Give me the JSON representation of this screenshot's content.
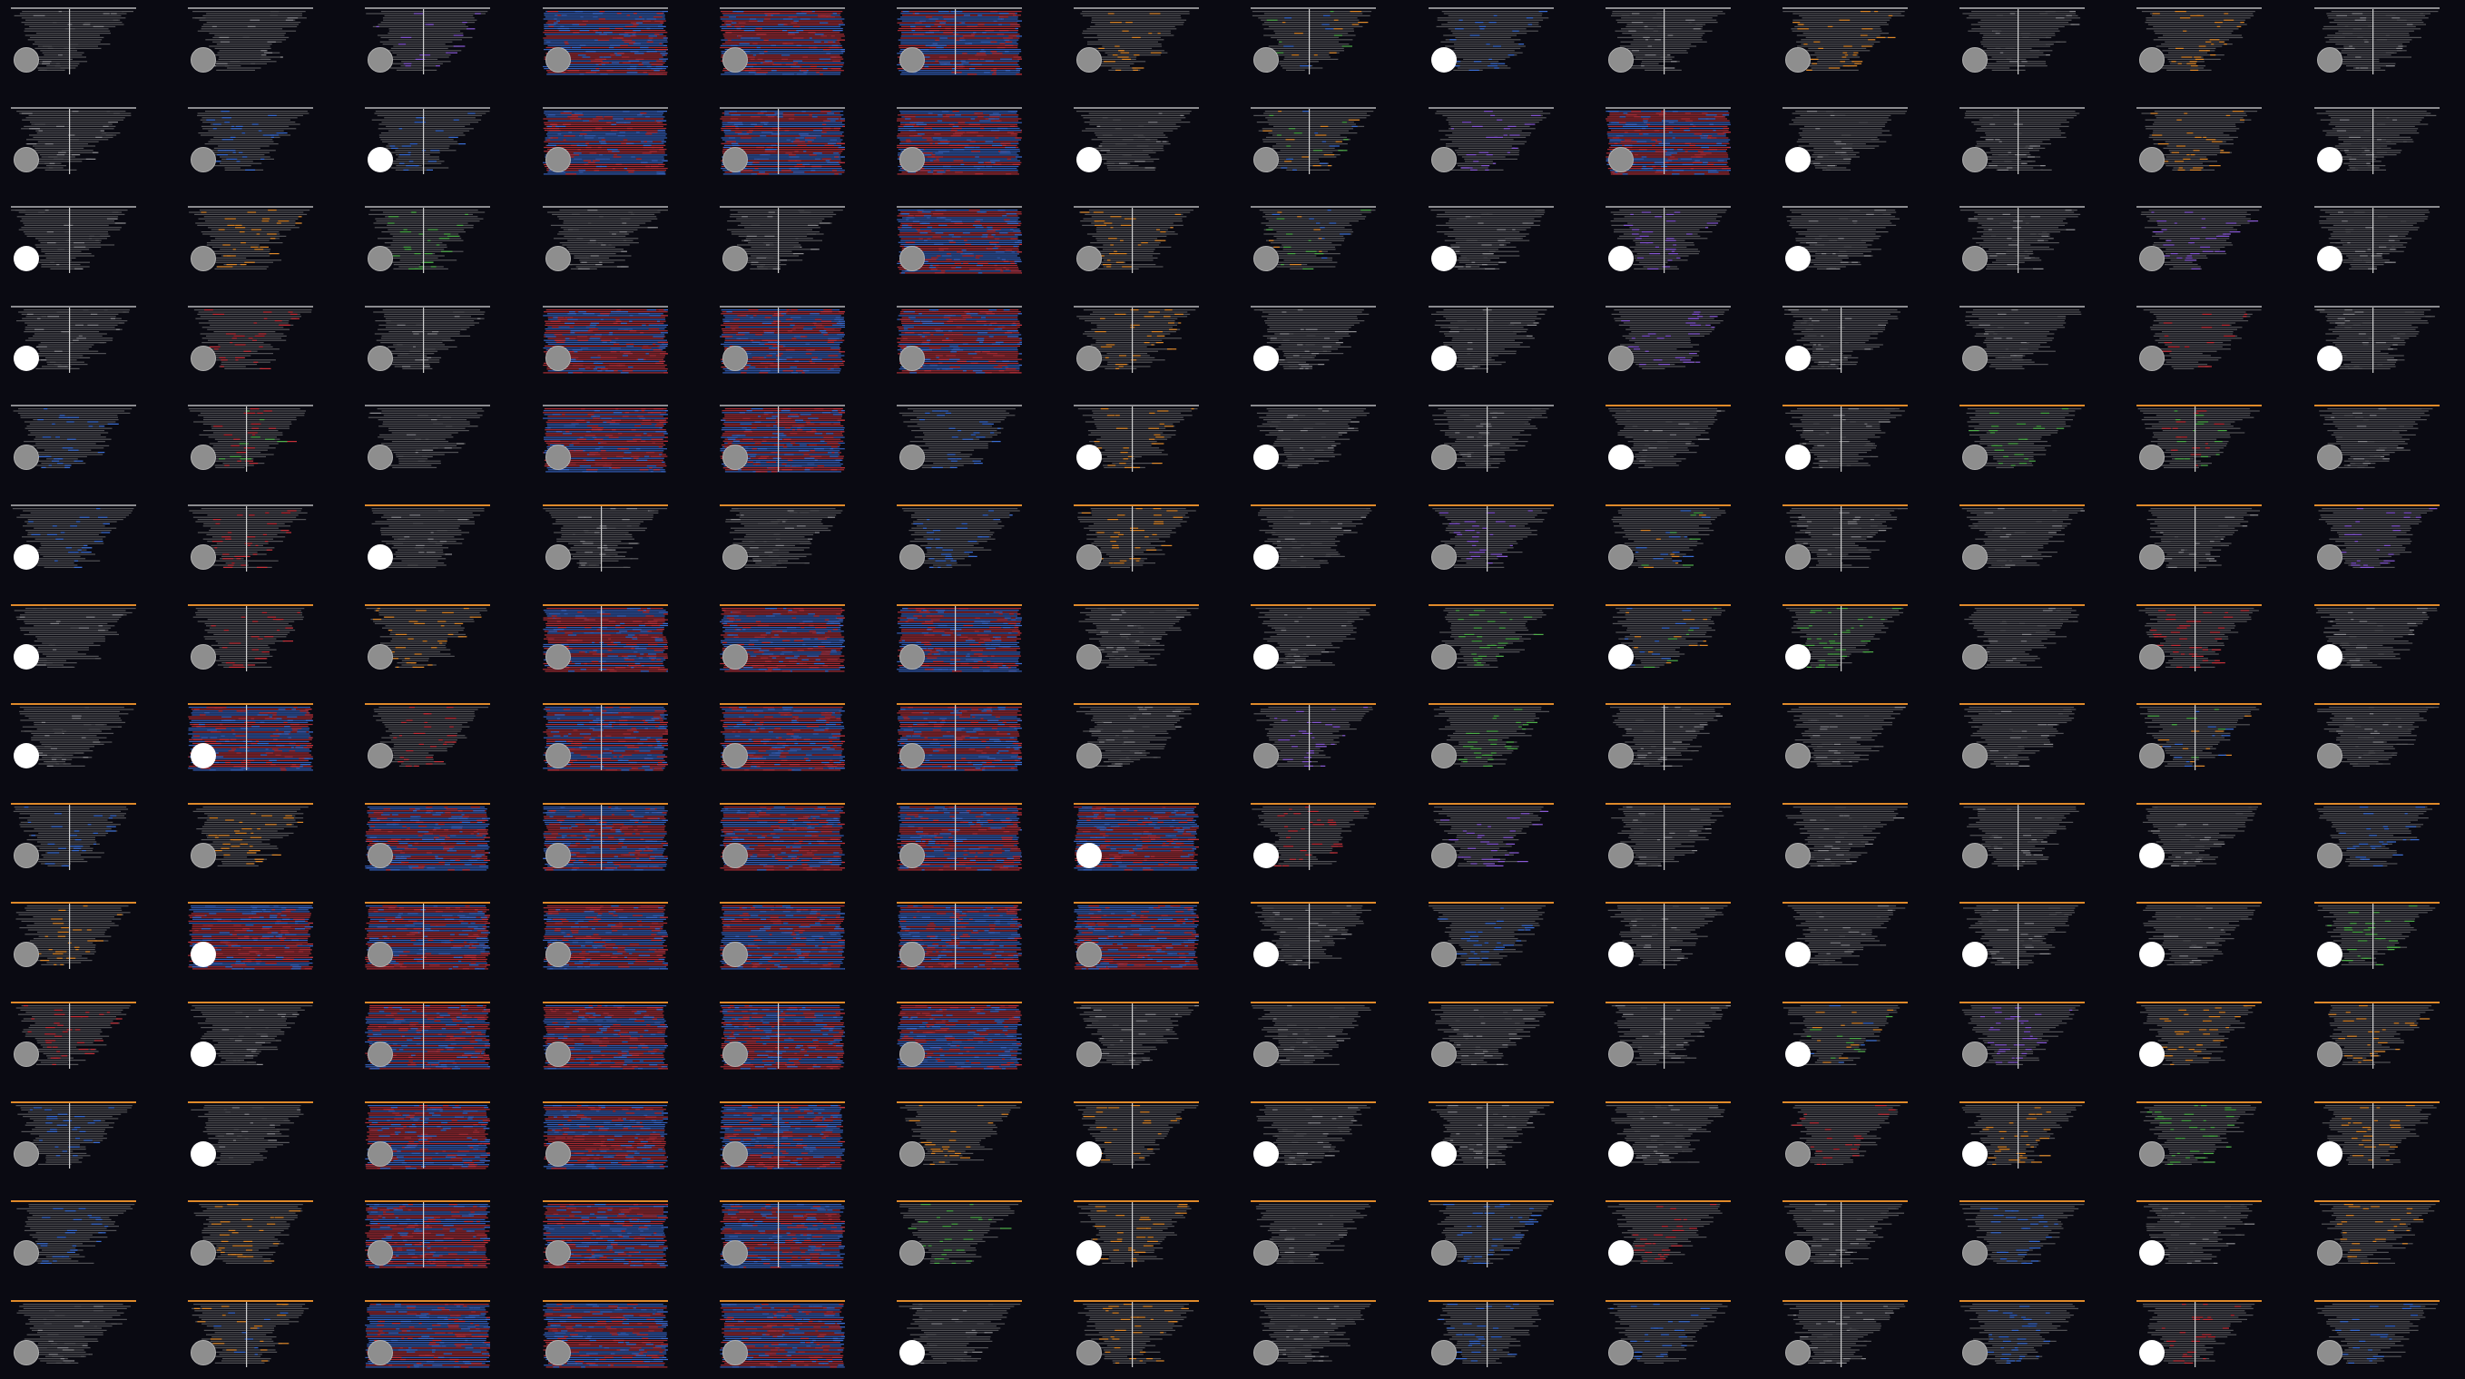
{
  "grid": {
    "rows": 14,
    "cols": 14,
    "background": "#0a0a12"
  },
  "palette": {
    "gray": "#5a5a5e",
    "light_gray": "#8c8c90",
    "blue": "#3b6fd6",
    "red": "#c8323a",
    "orange": "#e08a2a",
    "green": "#4fb04a",
    "purple": "#8a5ad6",
    "selected_dot": "#ffffff",
    "unselected_dot": "#8e8e8e"
  },
  "selection_dot_icon": "circle-toggle-icon",
  "selected": [
    [
      0,
      0,
      0,
      0,
      0,
      0,
      0,
      0,
      1,
      0,
      0,
      0,
      0,
      0
    ],
    [
      0,
      0,
      1,
      0,
      0,
      0,
      1,
      0,
      0,
      0,
      1,
      0,
      0,
      1
    ],
    [
      1,
      0,
      0,
      0,
      0,
      0,
      0,
      0,
      1,
      1,
      1,
      0,
      0,
      1
    ],
    [
      1,
      0,
      0,
      0,
      0,
      0,
      0,
      1,
      1,
      0,
      1,
      0,
      0,
      1
    ],
    [
      0,
      0,
      0,
      0,
      0,
      0,
      1,
      1,
      0,
      1,
      1,
      0,
      0,
      0
    ],
    [
      1,
      0,
      1,
      0,
      0,
      0,
      0,
      1,
      0,
      0,
      0,
      0,
      0,
      0
    ],
    [
      1,
      0,
      0,
      0,
      0,
      0,
      0,
      1,
      0,
      1,
      1,
      0,
      0,
      1
    ],
    [
      1,
      1,
      0,
      0,
      0,
      0,
      0,
      0,
      0,
      0,
      0,
      0,
      0,
      0
    ],
    [
      0,
      0,
      0,
      0,
      0,
      0,
      1,
      1,
      0,
      0,
      0,
      0,
      1,
      0
    ],
    [
      0,
      1,
      0,
      0,
      0,
      0,
      0,
      1,
      0,
      1,
      1,
      1,
      1,
      1
    ],
    [
      0,
      1,
      0,
      0,
      0,
      0,
      0,
      0,
      0,
      0,
      1,
      0,
      1,
      0
    ],
    [
      0,
      1,
      0,
      0,
      0,
      0,
      1,
      1,
      1,
      1,
      0,
      1,
      0,
      1
    ],
    [
      0,
      0,
      0,
      0,
      0,
      0,
      1,
      0,
      0,
      1,
      0,
      0,
      1,
      0
    ],
    [
      0,
      0,
      0,
      0,
      0,
      1,
      0,
      0,
      0,
      0,
      0,
      0,
      1,
      0
    ]
  ],
  "thumb_style": [
    [
      "g",
      "g",
      "gp",
      "rb",
      "b",
      "rb",
      "go",
      "og",
      "gb",
      "g",
      "go",
      "g",
      "go",
      "g"
    ],
    [
      "g",
      "gb",
      "gb",
      "rb",
      "b",
      "rb",
      "g",
      "og",
      "gp",
      "r",
      "g",
      "g",
      "go",
      "g"
    ],
    [
      "g",
      "go",
      "gg",
      "g",
      "g",
      "rb",
      "go",
      "og",
      "g",
      "gp",
      "g",
      "g",
      "gp",
      "g"
    ],
    [
      "g",
      "gr",
      "g",
      "rb",
      "rb",
      "rb",
      "go",
      "g",
      "g",
      "gp",
      "g",
      "g",
      "gr",
      "g"
    ],
    [
      "gb",
      "rg",
      "g",
      "b",
      "rb",
      "gb",
      "go",
      "g",
      "g",
      "g",
      "g",
      "gg",
      "rg",
      "g"
    ],
    [
      "gb",
      "gr",
      "g",
      "g",
      "g",
      "gb",
      "go",
      "g",
      "gp",
      "og",
      "g",
      "g",
      "g",
      "gp"
    ],
    [
      "g",
      "gr",
      "go",
      "rb",
      "b",
      "rb",
      "g",
      "g",
      "gg",
      "og",
      "gg",
      "g",
      "gr",
      "g"
    ],
    [
      "g",
      "b",
      "gr",
      "rb",
      "rb",
      "rb",
      "g",
      "gp",
      "gg",
      "g",
      "g",
      "g",
      "og",
      "g"
    ],
    [
      "gb",
      "go",
      "rb",
      "rb",
      "rb",
      "b",
      "b",
      "gr",
      "gp",
      "g",
      "g",
      "g",
      "g",
      "gb"
    ],
    [
      "go",
      "r",
      "rb",
      "rb",
      "b",
      "rb",
      "b",
      "g",
      "gb",
      "g",
      "g",
      "g",
      "g",
      "gg"
    ],
    [
      "gr",
      "g",
      "rb",
      "rb",
      "rb",
      "rb",
      "g",
      "g",
      "g",
      "g",
      "og",
      "gp",
      "go",
      "go"
    ],
    [
      "gb",
      "g",
      "r",
      "rb",
      "rb",
      "go",
      "go",
      "g",
      "g",
      "g",
      "gr",
      "go",
      "gg",
      "go"
    ],
    [
      "gb",
      "go",
      "r",
      "rb",
      "rb",
      "gg",
      "go",
      "g",
      "gb",
      "gr",
      "g",
      "gb",
      "g",
      "go"
    ],
    [
      "g",
      "o",
      "rb",
      "rb",
      "rb",
      "g",
      "go",
      "g",
      "gb",
      "gb",
      "g",
      "gb",
      "gr",
      "gb"
    ]
  ]
}
